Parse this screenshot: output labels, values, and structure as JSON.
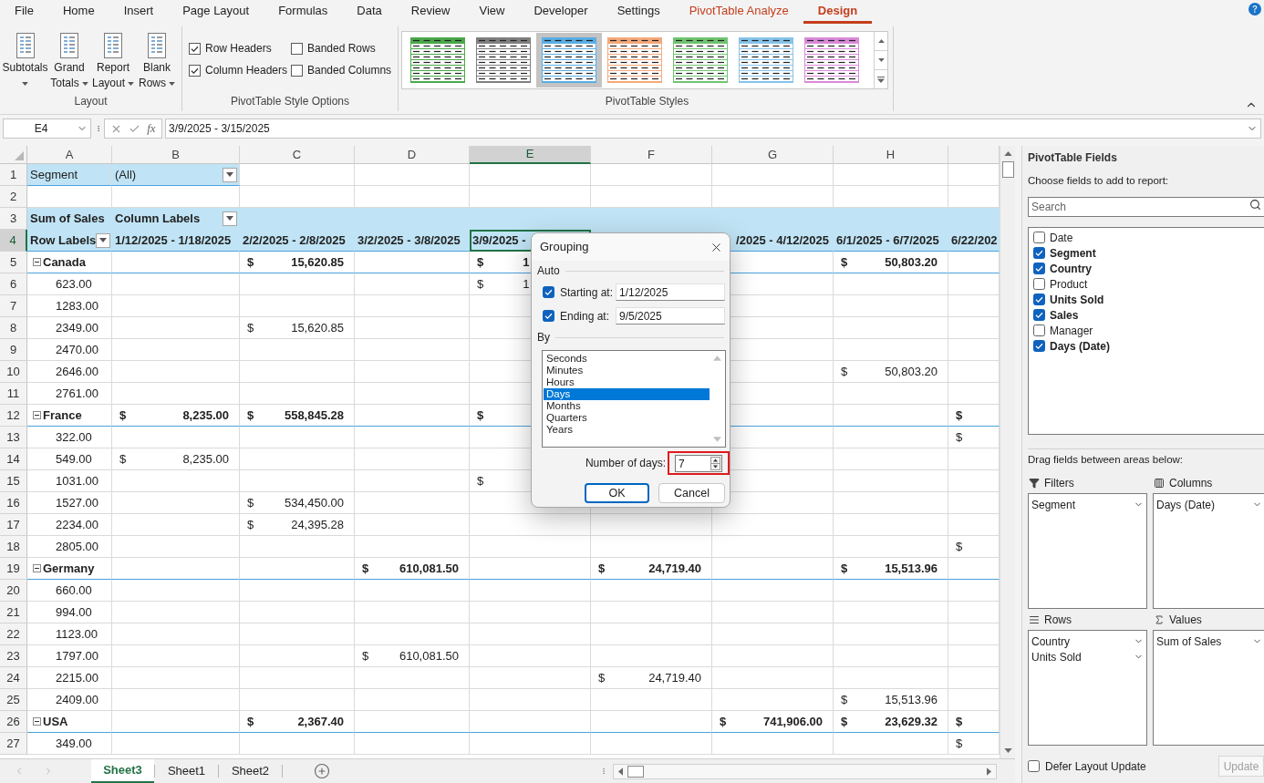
{
  "menu_tabs": [
    {
      "label": "File",
      "kind": "plain",
      "selected": false
    },
    {
      "label": "Home",
      "kind": "plain",
      "selected": false
    },
    {
      "label": "Insert",
      "kind": "plain",
      "selected": false
    },
    {
      "label": "Page Layout",
      "kind": "plain",
      "selected": false
    },
    {
      "label": "Formulas",
      "kind": "plain",
      "selected": false
    },
    {
      "label": "Data",
      "kind": "plain",
      "selected": false
    },
    {
      "label": "Review",
      "kind": "plain",
      "selected": false
    },
    {
      "label": "View",
      "kind": "plain",
      "selected": false
    },
    {
      "label": "Developer",
      "kind": "plain",
      "selected": false
    },
    {
      "label": "Settings",
      "kind": "plain",
      "selected": false
    },
    {
      "label": "PivotTable Analyze",
      "kind": "contextual",
      "selected": false
    },
    {
      "label": "Design",
      "kind": "contextual",
      "selected": true
    }
  ],
  "ribbon": {
    "layout_group": {
      "label": "Layout",
      "buttons": [
        {
          "lines": [
            "Subtotals"
          ]
        },
        {
          "lines": [
            "Grand",
            "Totals"
          ]
        },
        {
          "lines": [
            "Report",
            "Layout"
          ]
        },
        {
          "lines": [
            "Blank",
            "Rows"
          ]
        }
      ]
    },
    "style_options": {
      "label": "PivotTable Style Options",
      "checkboxes": [
        {
          "label": "Row Headers",
          "checked": true
        },
        {
          "label": "Banded Rows",
          "checked": false
        },
        {
          "label": "Column Headers",
          "checked": true
        },
        {
          "label": "Banded Columns",
          "checked": false
        }
      ]
    },
    "styles": {
      "label": "PivotTable Styles",
      "items": [
        {
          "color": "#4aa84a",
          "selected": false
        },
        {
          "color": "#7f7f7f",
          "selected": false
        },
        {
          "color": "#5aaee3",
          "selected": true
        },
        {
          "color": "#f4a97a",
          "selected": false
        },
        {
          "color": "#70c470",
          "selected": false
        },
        {
          "color": "#86c3ea",
          "selected": false
        },
        {
          "color": "#d98ad9",
          "selected": false
        }
      ]
    }
  },
  "formula_bar": {
    "name_box": "E4",
    "function_label": "fx",
    "formula": "3/9/2025 - 3/15/2025"
  },
  "grid": {
    "columns": [
      {
        "letter": "A",
        "selected": false
      },
      {
        "letter": "B",
        "selected": false
      },
      {
        "letter": "C",
        "selected": false
      },
      {
        "letter": "D",
        "selected": false
      },
      {
        "letter": "E",
        "selected": true
      },
      {
        "letter": "F",
        "selected": false
      },
      {
        "letter": "G",
        "selected": false
      },
      {
        "letter": "H",
        "selected": false
      },
      {
        "selected": false
      }
    ],
    "rows": [
      {
        "number": "1",
        "kind": "filter",
        "selected": false,
        "cells": {
          "A": {
            "kind": "text",
            "text": "Segment"
          },
          "B": {
            "kind": "dropdown",
            "text": "(All)"
          }
        }
      },
      {
        "number": "2",
        "kind": "blank",
        "selected": false
      },
      {
        "number": "3",
        "kind": "header",
        "selected": false,
        "cells": {
          "A": {
            "kind": "text",
            "text": "Sum of Sales"
          },
          "B": {
            "kind": "dropdown",
            "text": "Column Labels"
          }
        }
      },
      {
        "number": "4",
        "kind": "labels",
        "selected": true,
        "cells": {
          "A": {
            "kind": "dropdown",
            "text": "Row Labels"
          },
          "B": {
            "kind": "text",
            "text": "1/12/2025 - 1/18/2025"
          },
          "C": {
            "kind": "text",
            "text": "2/2/2025 - 2/8/2025"
          },
          "D": {
            "kind": "text",
            "text": "3/2/2025 - 3/8/2025"
          },
          "E": {
            "kind": "text",
            "text": "3/9/2025 -"
          },
          "G": {
            "kind": "text_end",
            "text": "/2025 - 4/12/2025"
          },
          "H": {
            "kind": "text",
            "text": "6/1/2025 - 6/7/2025"
          },
          "I": {
            "kind": "text",
            "text": "6/22/202"
          }
        }
      },
      {
        "number": "5",
        "kind": "group",
        "selected": false,
        "cells": {
          "A": {
            "kind": "group",
            "text": "Canada",
            "expanded": true
          },
          "C": {
            "kind": "money",
            "symbol": "$",
            "amount": "15,620.85"
          },
          "E": {
            "kind": "money_cut",
            "symbol": "$",
            "amount": "1"
          },
          "H": {
            "kind": "money",
            "symbol": "$",
            "amount": "50,803.20"
          }
        }
      },
      {
        "number": "6",
        "kind": "item",
        "selected": false,
        "cells": {
          "A": {
            "kind": "item",
            "text": "623.00"
          },
          "E": {
            "kind": "money_cut",
            "symbol": "$",
            "amount": "1"
          }
        }
      },
      {
        "number": "7",
        "kind": "item",
        "selected": false,
        "cells": {
          "A": {
            "kind": "item",
            "text": "1283.00"
          }
        }
      },
      {
        "number": "8",
        "kind": "item",
        "selected": false,
        "cells": {
          "A": {
            "kind": "item",
            "text": "2349.00"
          },
          "C": {
            "kind": "money",
            "symbol": "$",
            "amount": "15,620.85"
          }
        }
      },
      {
        "number": "9",
        "kind": "item",
        "selected": false,
        "cells": {
          "A": {
            "kind": "item",
            "text": "2470.00"
          }
        }
      },
      {
        "number": "10",
        "kind": "item",
        "selected": false,
        "cells": {
          "A": {
            "kind": "item",
            "text": "2646.00"
          },
          "H": {
            "kind": "money",
            "symbol": "$",
            "amount": "50,803.20"
          }
        }
      },
      {
        "number": "11",
        "kind": "item",
        "selected": false,
        "cells": {
          "A": {
            "kind": "item",
            "text": "2761.00"
          }
        }
      },
      {
        "number": "12",
        "kind": "group",
        "selected": false,
        "cells": {
          "A": {
            "kind": "group",
            "text": "France",
            "expanded": true
          },
          "B": {
            "kind": "money",
            "symbol": "$",
            "amount": "8,235.00"
          },
          "C": {
            "kind": "money",
            "symbol": "$",
            "amount": "558,845.28"
          },
          "E": {
            "kind": "money",
            "symbol": "$"
          },
          "I": {
            "kind": "money",
            "symbol": "$"
          }
        }
      },
      {
        "number": "13",
        "kind": "item",
        "selected": false,
        "cells": {
          "A": {
            "kind": "item",
            "text": "322.00"
          },
          "I": {
            "kind": "money",
            "symbol": "$"
          }
        }
      },
      {
        "number": "14",
        "kind": "item",
        "selected": false,
        "cells": {
          "A": {
            "kind": "item",
            "text": "549.00"
          },
          "B": {
            "kind": "money",
            "symbol": "$",
            "amount": "8,235.00"
          }
        }
      },
      {
        "number": "15",
        "kind": "item",
        "selected": false,
        "cells": {
          "A": {
            "kind": "item",
            "text": "1031.00"
          },
          "E": {
            "kind": "money",
            "symbol": "$"
          }
        }
      },
      {
        "number": "16",
        "kind": "item",
        "selected": false,
        "cells": {
          "A": {
            "kind": "item",
            "text": "1527.00"
          },
          "C": {
            "kind": "money",
            "symbol": "$",
            "amount": "534,450.00"
          }
        }
      },
      {
        "number": "17",
        "kind": "item",
        "selected": false,
        "cells": {
          "A": {
            "kind": "item",
            "text": "2234.00"
          },
          "C": {
            "kind": "money",
            "symbol": "$",
            "amount": "24,395.28"
          }
        }
      },
      {
        "number": "18",
        "kind": "item",
        "selected": false,
        "cells": {
          "A": {
            "kind": "item",
            "text": "2805.00"
          },
          "I": {
            "kind": "money",
            "symbol": "$"
          }
        }
      },
      {
        "number": "19",
        "kind": "group",
        "selected": false,
        "cells": {
          "A": {
            "kind": "group",
            "text": "Germany",
            "expanded": true
          },
          "D": {
            "kind": "money",
            "symbol": "$",
            "amount": "610,081.50"
          },
          "F": {
            "kind": "money",
            "symbol": "$",
            "amount": "24,719.40"
          },
          "H": {
            "kind": "money",
            "symbol": "$",
            "amount": "15,513.96"
          }
        }
      },
      {
        "number": "20",
        "kind": "item",
        "selected": false,
        "cells": {
          "A": {
            "kind": "item",
            "text": "660.00"
          }
        }
      },
      {
        "number": "21",
        "kind": "item",
        "selected": false,
        "cells": {
          "A": {
            "kind": "item",
            "text": "994.00"
          }
        }
      },
      {
        "number": "22",
        "kind": "item",
        "selected": false,
        "cells": {
          "A": {
            "kind": "item",
            "text": "1123.00"
          }
        }
      },
      {
        "number": "23",
        "kind": "item",
        "selected": false,
        "cells": {
          "A": {
            "kind": "item",
            "text": "1797.00"
          },
          "D": {
            "kind": "money",
            "symbol": "$",
            "amount": "610,081.50"
          }
        }
      },
      {
        "number": "24",
        "kind": "item",
        "selected": false,
        "cells": {
          "A": {
            "kind": "item",
            "text": "2215.00"
          },
          "F": {
            "kind": "money",
            "symbol": "$",
            "amount": "24,719.40"
          }
        }
      },
      {
        "number": "25",
        "kind": "item",
        "selected": false,
        "cells": {
          "A": {
            "kind": "item",
            "text": "2409.00"
          },
          "H": {
            "kind": "money",
            "symbol": "$",
            "amount": "15,513.96"
          }
        }
      },
      {
        "number": "26",
        "kind": "group",
        "selected": false,
        "cells": {
          "A": {
            "kind": "group",
            "text": "USA",
            "expanded": true
          },
          "C": {
            "kind": "money",
            "symbol": "$",
            "amount": "2,367.40"
          },
          "G": {
            "kind": "money",
            "symbol": "$",
            "amount": "741,906.00"
          },
          "H": {
            "kind": "money",
            "symbol": "$",
            "amount": "23,629.32"
          },
          "I": {
            "kind": "money",
            "symbol": "$"
          }
        }
      },
      {
        "number": "27",
        "kind": "item",
        "selected": false,
        "cells": {
          "A": {
            "kind": "item",
            "text": "349.00"
          },
          "I": {
            "kind": "money",
            "symbol": "$"
          }
        }
      }
    ]
  },
  "sheet_tabs": [
    {
      "label": "Sheet3",
      "selected": true
    },
    {
      "label": "Sheet1",
      "selected": false
    },
    {
      "label": "Sheet2",
      "selected": false
    }
  ],
  "field_list": {
    "title": "PivotTable Fields",
    "subtitle": "Choose fields to add to report:",
    "search": {
      "placeholder": "Search"
    },
    "fields": [
      {
        "label": "Date",
        "checked": false
      },
      {
        "label": "Segment",
        "checked": true
      },
      {
        "label": "Country",
        "checked": true
      },
      {
        "label": "Product",
        "checked": false
      },
      {
        "label": "Units Sold",
        "checked": true
      },
      {
        "label": "Sales",
        "checked": true
      },
      {
        "label": "Manager",
        "checked": false
      },
      {
        "label": "Days (Date)",
        "checked": true
      }
    ],
    "areas_hint": "Drag fields between areas below:",
    "areas": [
      {
        "kind": "filters",
        "label": "Filters",
        "items": [
          "Segment"
        ]
      },
      {
        "kind": "columns",
        "label": "Columns",
        "items": [
          "Days (Date)"
        ]
      },
      {
        "kind": "rows",
        "label": "Rows",
        "items": [
          "Country",
          "Units Sold"
        ]
      },
      {
        "kind": "values",
        "label": "Values",
        "items": [
          "Sum of Sales"
        ]
      }
    ],
    "defer": {
      "label": "Defer Layout Update",
      "checked": false
    },
    "update_button": {
      "label": "Update",
      "disabled": true
    }
  },
  "dialog": {
    "title": "Grouping",
    "auto_label": "Auto",
    "start": {
      "label": "Starting at:",
      "checked": true,
      "value": "1/12/2025"
    },
    "end": {
      "label": "Ending at:",
      "checked": true,
      "value": "9/5/2025"
    },
    "by_label": "By",
    "units": [
      {
        "label": "Seconds",
        "selected": false
      },
      {
        "label": "Minutes",
        "selected": false
      },
      {
        "label": "Hours",
        "selected": false
      },
      {
        "label": "Days",
        "selected": true
      },
      {
        "label": "Months",
        "selected": false
      },
      {
        "label": "Quarters",
        "selected": false
      },
      {
        "label": "Years",
        "selected": false
      }
    ],
    "number": {
      "label": "Number of days:",
      "value": "7",
      "highlighted": true
    },
    "buttons": [
      {
        "label": "OK",
        "kind": "default"
      },
      {
        "label": "Cancel",
        "kind": "normal"
      }
    ]
  }
}
